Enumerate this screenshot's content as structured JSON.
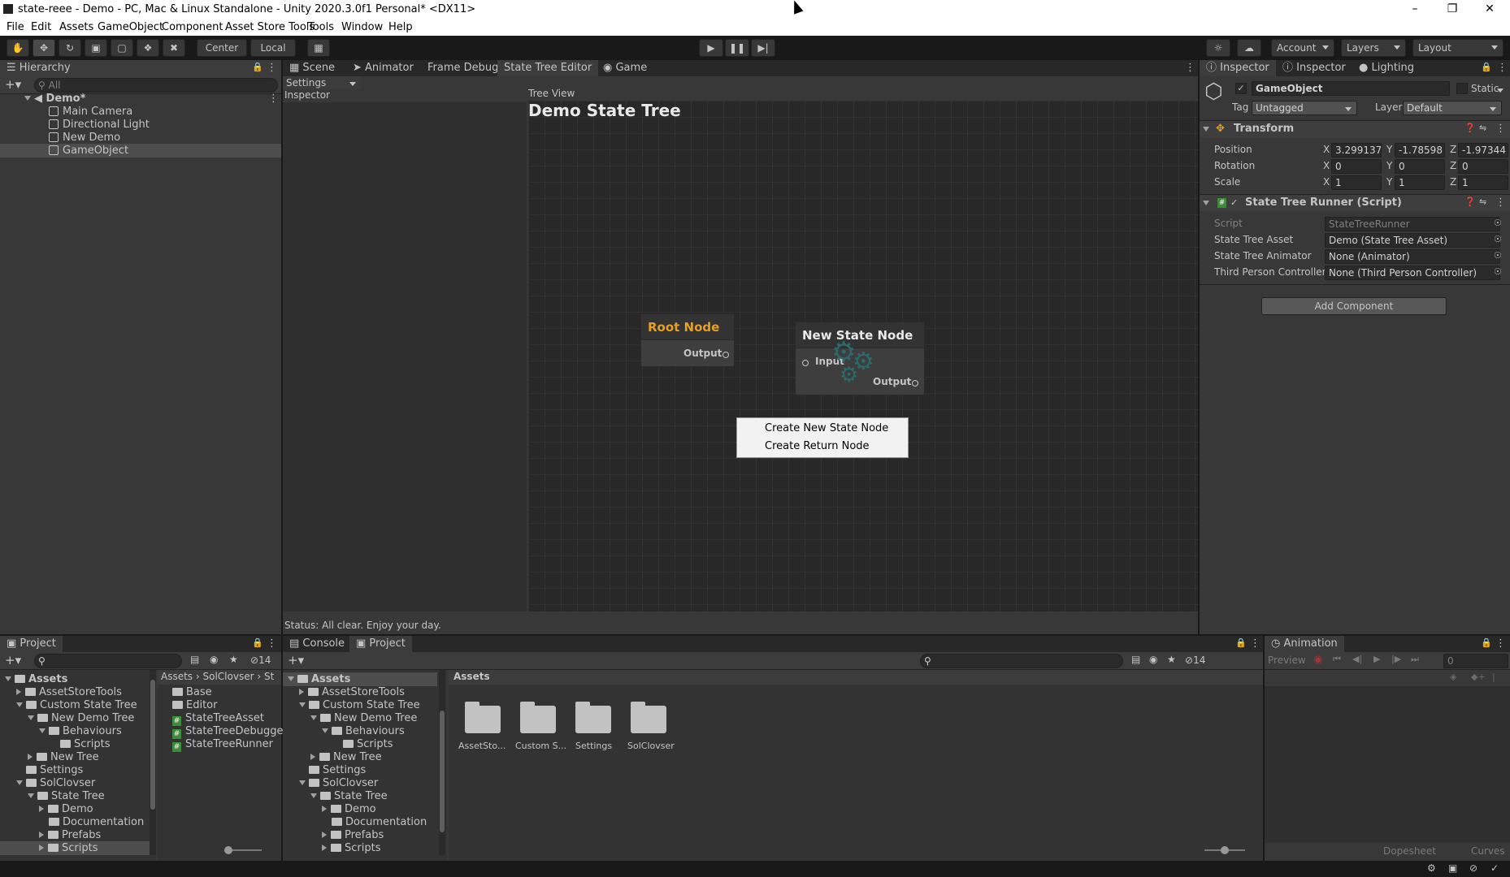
{
  "window": {
    "title": "state-reee - Demo - PC, Mac & Linux Standalone - Unity 2020.3.0f1 Personal* <DX11>"
  },
  "menu": [
    "File",
    "Edit",
    "Assets",
    "GameObject",
    "Component",
    "Asset Store Tools",
    "Tools",
    "Window",
    "Help"
  ],
  "toolbar": {
    "center": "Center",
    "local": "Local",
    "account": "Account",
    "layers": "Layers",
    "layout": "Layout"
  },
  "hierarchy": {
    "title": "Hierarchy",
    "search_placeholder": "All",
    "scene": "Demo*",
    "items": [
      "Main Camera",
      "Directional Light",
      "New Demo",
      "GameObject"
    ]
  },
  "center_tabs": [
    "Scene",
    "Animator",
    "Frame Debug",
    "State Tree Editor",
    "Game"
  ],
  "state_tree_editor": {
    "settings": "Settings",
    "inspector_label": "Inspector",
    "tree_view_label": "Tree View",
    "tree_title": "Demo State Tree",
    "status": "Status: All clear. Enjoy your day.",
    "root_node": {
      "title": "Root Node",
      "output": "Output"
    },
    "state_node": {
      "title": "New State Node",
      "input": "Input",
      "output": "Output"
    },
    "context_menu": [
      "Create New State Node",
      "Create Return Node"
    ]
  },
  "inspector": {
    "tabs": [
      "Inspector",
      "Inspector",
      "Lighting"
    ],
    "object_name": "GameObject",
    "static": "Static",
    "tag_label": "Tag",
    "tag": "Untagged",
    "layer_label": "Layer",
    "layer": "Default",
    "transform": {
      "title": "Transform",
      "position": {
        "label": "Position",
        "x": "3.299137",
        "y": "-1.78598",
        "z": "-1.97344"
      },
      "rotation": {
        "label": "Rotation",
        "x": "0",
        "y": "0",
        "z": "0"
      },
      "scale": {
        "label": "Scale",
        "x": "1",
        "y": "1",
        "z": "1"
      }
    },
    "runner": {
      "title": "State Tree Runner (Script)",
      "fields": [
        {
          "label": "Script",
          "value": "StateTreeRunner"
        },
        {
          "label": "State Tree Asset",
          "value": "Demo (State Tree Asset)"
        },
        {
          "label": "State Tree Animator",
          "value": "None (Animator)"
        },
        {
          "label": "Third Person Controller",
          "value": "None (Third Person Controller)"
        }
      ]
    },
    "add_component": "Add Component"
  },
  "project_left": {
    "title": "Project",
    "hidden_count": "14",
    "tree": [
      "Assets",
      "AssetStoreTools",
      "Custom State Tree",
      "New Demo Tree",
      "Behaviours",
      "Scripts",
      "New Tree",
      "Settings",
      "SolClovser",
      "State Tree",
      "Demo",
      "Documentation",
      "Prefabs",
      "Scripts"
    ],
    "breadcrumb": [
      "Assets",
      "SolClovser",
      "St"
    ],
    "files": [
      "Base",
      "Editor",
      "StateTreeAsset",
      "StateTreeDebugger",
      "StateTreeRunner"
    ]
  },
  "bottom_tabs": [
    "Console",
    "Project"
  ],
  "project_right": {
    "hidden_count": "14",
    "tree": [
      "Assets",
      "AssetStoreTools",
      "Custom State Tree",
      "New Demo Tree",
      "Behaviours",
      "Scripts",
      "New Tree",
      "Settings",
      "SolClovser",
      "State Tree",
      "Demo",
      "Documentation",
      "Prefabs",
      "Scripts"
    ],
    "header": "Assets",
    "folders": [
      "AssetSto...",
      "Custom S...",
      "Settings",
      "SolClovser"
    ]
  },
  "animation": {
    "title": "Animation",
    "preview": "Preview",
    "frame": "0",
    "dopesheet": "Dopesheet",
    "curves": "Curves"
  }
}
